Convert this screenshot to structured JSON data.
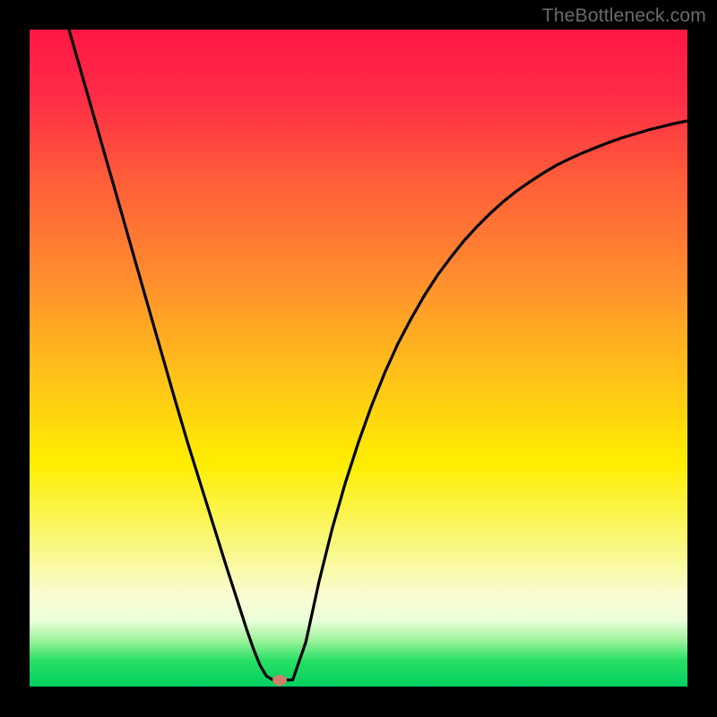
{
  "watermark": "TheBottleneck.com",
  "chart_data": {
    "type": "line",
    "title": "",
    "xlabel": "",
    "ylabel": "",
    "xlim": [
      0,
      1
    ],
    "ylim": [
      0,
      1
    ],
    "gradient_description": "vertical red-to-green heat gradient; red at top (high bottleneck), green at bottom (no bottleneck)",
    "series": [
      {
        "name": "bottleneck-curve",
        "x": [
          0.06,
          0.08,
          0.1,
          0.12,
          0.14,
          0.16,
          0.18,
          0.2,
          0.22,
          0.24,
          0.26,
          0.28,
          0.3,
          0.32,
          0.33,
          0.34,
          0.35,
          0.36,
          0.37,
          0.38,
          0.4,
          0.42,
          0.44,
          0.46,
          0.48,
          0.5,
          0.52,
          0.54,
          0.56,
          0.58,
          0.6,
          0.62,
          0.64,
          0.66,
          0.68,
          0.7,
          0.72,
          0.74,
          0.76,
          0.78,
          0.8,
          0.82,
          0.84,
          0.86,
          0.88,
          0.9,
          0.92,
          0.94,
          0.96,
          0.98,
          1.0
        ],
        "y": [
          1.0,
          0.93,
          0.86,
          0.79,
          0.72,
          0.65,
          0.58,
          0.51,
          0.44,
          0.372,
          0.308,
          0.244,
          0.18,
          0.118,
          0.087,
          0.058,
          0.033,
          0.016,
          0.01,
          0.01,
          0.01,
          0.068,
          0.16,
          0.24,
          0.31,
          0.372,
          0.428,
          0.478,
          0.522,
          0.56,
          0.595,
          0.626,
          0.653,
          0.678,
          0.7,
          0.72,
          0.738,
          0.754,
          0.768,
          0.781,
          0.793,
          0.803,
          0.812,
          0.82,
          0.828,
          0.835,
          0.841,
          0.847,
          0.852,
          0.857,
          0.861
        ]
      }
    ],
    "marker": {
      "x": 0.38,
      "y": 0.01,
      "name": "optimal-point"
    },
    "gradient_stops": [
      {
        "pos": 0.0,
        "color": "#ff1744"
      },
      {
        "pos": 0.1,
        "color": "#ff2b47"
      },
      {
        "pos": 0.22,
        "color": "#ff5a3a"
      },
      {
        "pos": 0.38,
        "color": "#ff8e2e"
      },
      {
        "pos": 0.54,
        "color": "#ffc617"
      },
      {
        "pos": 0.66,
        "color": "#ffee00"
      },
      {
        "pos": 0.78,
        "color": "#f8f87a"
      },
      {
        "pos": 0.86,
        "color": "#fbfbd2"
      },
      {
        "pos": 0.9,
        "color": "#eaffd8"
      },
      {
        "pos": 0.93,
        "color": "#9cf29a"
      },
      {
        "pos": 0.96,
        "color": "#29e065"
      },
      {
        "pos": 1.0,
        "color": "#00d060"
      }
    ]
  }
}
